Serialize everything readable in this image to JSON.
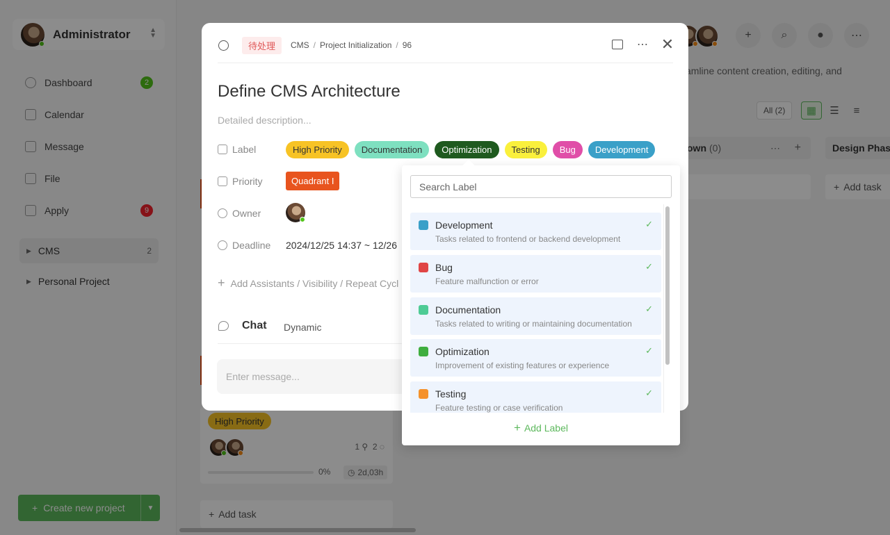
{
  "user": {
    "name": "Administrator"
  },
  "nav": [
    {
      "label": "Dashboard",
      "badge": "2",
      "badge_color": "#52c41a"
    },
    {
      "label": "Calendar"
    },
    {
      "label": "Message"
    },
    {
      "label": "File"
    },
    {
      "label": "Apply",
      "badge": "9",
      "badge_color": "#f5222d"
    }
  ],
  "projects": [
    {
      "label": "CMS",
      "count": "2"
    },
    {
      "label": "Personal Project"
    }
  ],
  "create_project": "Create new project",
  "background": {
    "description_fragment": "amline content creation, editing, and",
    "view_all": "All (2)",
    "column_1": {
      "name": "own",
      "count": "(0)"
    },
    "column_2": {
      "name": "Design Phas"
    },
    "add_task": "Add task",
    "task_card": {
      "tag": "High Priority",
      "subtasks": "1",
      "comments": "2",
      "progress": "0%",
      "time": "2d,03h"
    }
  },
  "modal": {
    "status": "待处理",
    "breadcrumb": [
      "CMS",
      "Project Initialization",
      "96"
    ],
    "title": "Define CMS Architecture",
    "description_placeholder": "Detailed description...",
    "fields": {
      "label": "Label",
      "priority": "Priority",
      "owner": "Owner",
      "deadline": "Deadline"
    },
    "labels": [
      {
        "text": "High Priority",
        "bg": "#f7c325",
        "fg": "#333333"
      },
      {
        "text": "Documentation",
        "bg": "#7ee0c0",
        "fg": "#333333"
      },
      {
        "text": "Optimization",
        "bg": "#1f5a1f",
        "fg": "#ffffff"
      },
      {
        "text": "Testing",
        "bg": "#faf03c",
        "fg": "#333333"
      },
      {
        "text": "Bug",
        "bg": "#e04ea8",
        "fg": "#ffffff"
      },
      {
        "text": "Development",
        "bg": "#3aa0c8",
        "fg": "#ffffff"
      }
    ],
    "priority_value": "Quadrant I",
    "deadline_value": "2024/12/25 14:37 ~ 12/26",
    "add_assistants": "Add Assistants / Visibility / Repeat Cycl",
    "chat_tab": "Chat",
    "dynamic_tab": "Dynamic",
    "message_placeholder": "Enter message..."
  },
  "label_dropdown": {
    "search_placeholder": "Search Label",
    "items": [
      {
        "name": "Development",
        "desc": "Tasks related to frontend or backend development",
        "color": "#3aa0c8",
        "checked": true
      },
      {
        "name": "Bug",
        "desc": "Feature malfunction or error",
        "color": "#e04545",
        "checked": true
      },
      {
        "name": "Documentation",
        "desc": "Tasks related to writing or maintaining documentation",
        "color": "#4ecb95",
        "checked": true
      },
      {
        "name": "Optimization",
        "desc": "Improvement of existing features or experience",
        "color": "#3fae3f",
        "checked": true
      },
      {
        "name": "Testing",
        "desc": "Feature testing or case verification",
        "color": "#f5922b",
        "checked": true
      }
    ],
    "add_label": "Add Label",
    "check_glyph": "✓"
  }
}
